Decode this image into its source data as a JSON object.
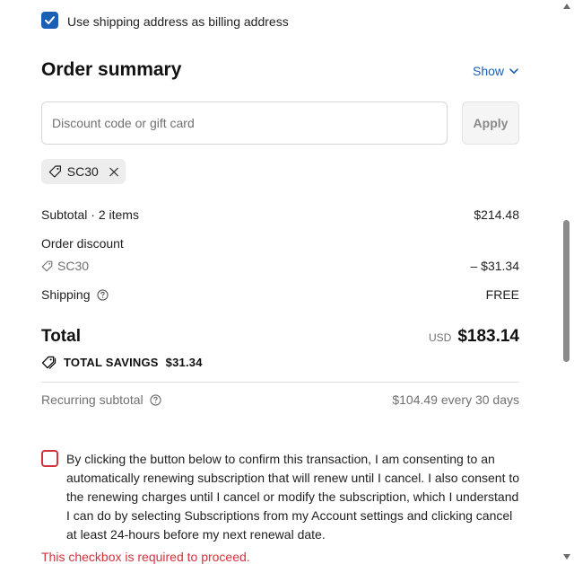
{
  "billing": {
    "checkbox_label": "Use shipping address as billing address",
    "checked": true
  },
  "summary": {
    "title": "Order summary",
    "show_label": "Show"
  },
  "discount": {
    "placeholder": "Discount code or gift card",
    "apply_label": "Apply",
    "applied_code": "SC30"
  },
  "rows": {
    "subtotal_label": "Subtotal · 2 items",
    "subtotal_value": "$214.48",
    "order_discount_label": "Order discount",
    "discount_code": "SC30",
    "discount_value": "– $31.34",
    "shipping_label": "Shipping",
    "shipping_value": "FREE"
  },
  "total": {
    "label": "Total",
    "currency": "USD",
    "amount": "$183.14",
    "savings_label": "TOTAL SAVINGS",
    "savings_value": "$31.34"
  },
  "recurring": {
    "label": "Recurring subtotal",
    "value": "$104.49 every 30 days"
  },
  "consent": {
    "text": "By clicking the button below to confirm this transaction, I am consenting to an automatically renewing subscription that will renew until I cancel. I also consent to the renewing charges until I cancel or modify the subscription, which I understand I can do by selecting Subscriptions from my Account settings and clicking cancel at least 24-hours before my next renewal date.",
    "checked": false,
    "error": "This checkbox is required to proceed."
  },
  "colors": {
    "accent": "#1a5fb4",
    "error": "#d3323b",
    "muted": "#707070"
  }
}
